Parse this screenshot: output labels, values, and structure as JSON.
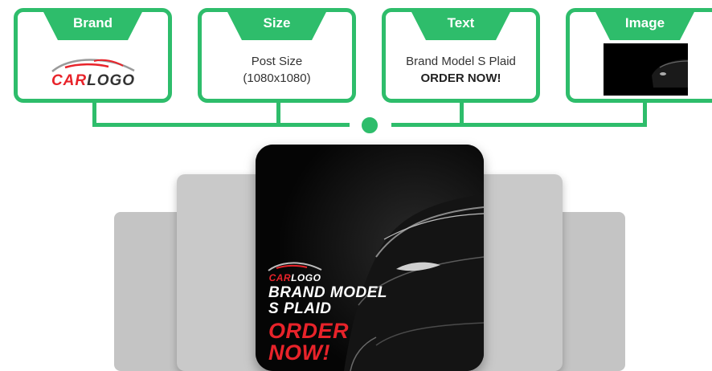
{
  "cards": [
    {
      "title": "Brand",
      "logo_text": "CARLOGO"
    },
    {
      "title": "Size",
      "line1": "Post Size",
      "line2": "(1080x1080)"
    },
    {
      "title": "Text",
      "line1": "Brand Model S Plaid",
      "line2": "ORDER NOW!"
    },
    {
      "title": "Image"
    }
  ],
  "post": {
    "logo_text": "CARLOGO",
    "headline_line1": "BRAND MODEL",
    "headline_line2": "S PLAID",
    "cta_line1": "ORDER",
    "cta_line2": "NOW!"
  },
  "colors": {
    "accent_green": "#2ebd6b",
    "logo_red": "#e8232a",
    "dark": "#050505"
  }
}
